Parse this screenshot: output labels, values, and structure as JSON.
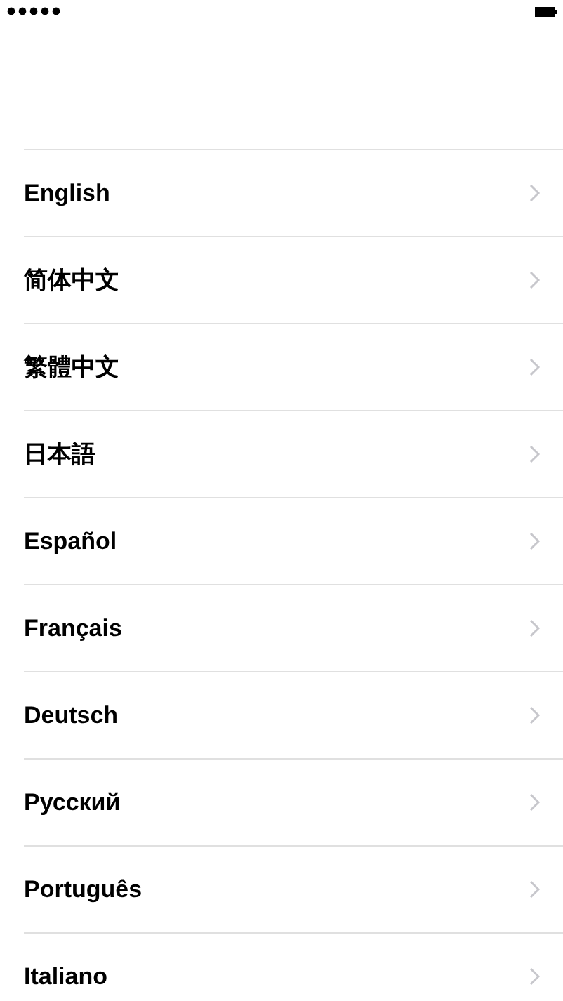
{
  "languages": [
    {
      "label": "English"
    },
    {
      "label": "简体中文"
    },
    {
      "label": "繁體中文"
    },
    {
      "label": "日本語"
    },
    {
      "label": "Español"
    },
    {
      "label": "Français"
    },
    {
      "label": "Deutsch"
    },
    {
      "label": "Русский"
    },
    {
      "label": "Português"
    },
    {
      "label": "Italiano"
    }
  ]
}
